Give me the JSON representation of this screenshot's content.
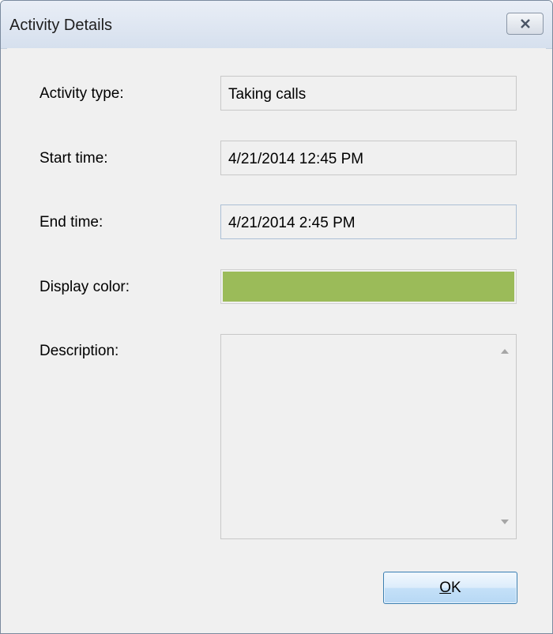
{
  "window": {
    "title": "Activity Details",
    "close_icon": "close-icon"
  },
  "form": {
    "activity_type_label": "Activity type:",
    "activity_type_value": "Taking calls",
    "start_time_label": "Start time:",
    "start_time_value": "4/21/2014 12:45 PM",
    "end_time_label": "End time:",
    "end_time_value": "4/21/2014 2:45 PM",
    "display_color_label": "Display color:",
    "display_color_value": "#9bbb59",
    "description_label": "Description:",
    "description_value": ""
  },
  "buttons": {
    "ok_mnemonic": "O",
    "ok_rest": "K"
  }
}
